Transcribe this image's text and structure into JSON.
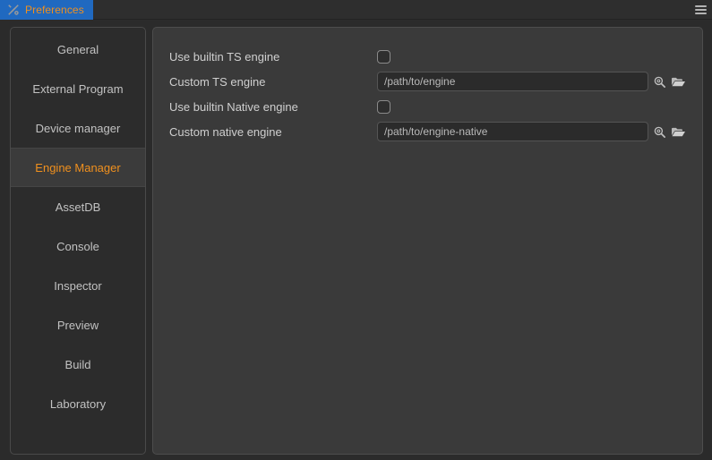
{
  "window": {
    "tab": {
      "label": "Preferences",
      "icon": "tools-icon",
      "accent_bg": "#2069c0",
      "label_color": "#f0901e"
    },
    "menu_icon": "hamburger-menu-icon"
  },
  "sidebar": {
    "items": [
      {
        "label": "General",
        "selected": false
      },
      {
        "label": "External Program",
        "selected": false
      },
      {
        "label": "Device manager",
        "selected": false
      },
      {
        "label": "Engine Manager",
        "selected": true
      },
      {
        "label": "AssetDB",
        "selected": false
      },
      {
        "label": "Console",
        "selected": false
      },
      {
        "label": "Inspector",
        "selected": false
      },
      {
        "label": "Preview",
        "selected": false
      },
      {
        "label": "Build",
        "selected": false
      },
      {
        "label": "Laboratory",
        "selected": false
      }
    ],
    "selected_color": "#f0901e"
  },
  "main": {
    "rows": [
      {
        "label": "Use builtin TS engine",
        "type": "checkbox",
        "checked": false
      },
      {
        "label": "Custom TS engine",
        "type": "path",
        "value": "/path/to/engine",
        "placeholder": "/path/to/engine",
        "search_icon": "magnifier-icon",
        "browse_icon": "folder-open-icon"
      },
      {
        "label": "Use builtin Native engine",
        "type": "checkbox",
        "checked": false
      },
      {
        "label": "Custom native engine",
        "type": "path",
        "value": "/path/to/engine-native",
        "placeholder": "/path/to/engine-native",
        "search_icon": "magnifier-icon",
        "browse_icon": "folder-open-icon"
      }
    ]
  }
}
